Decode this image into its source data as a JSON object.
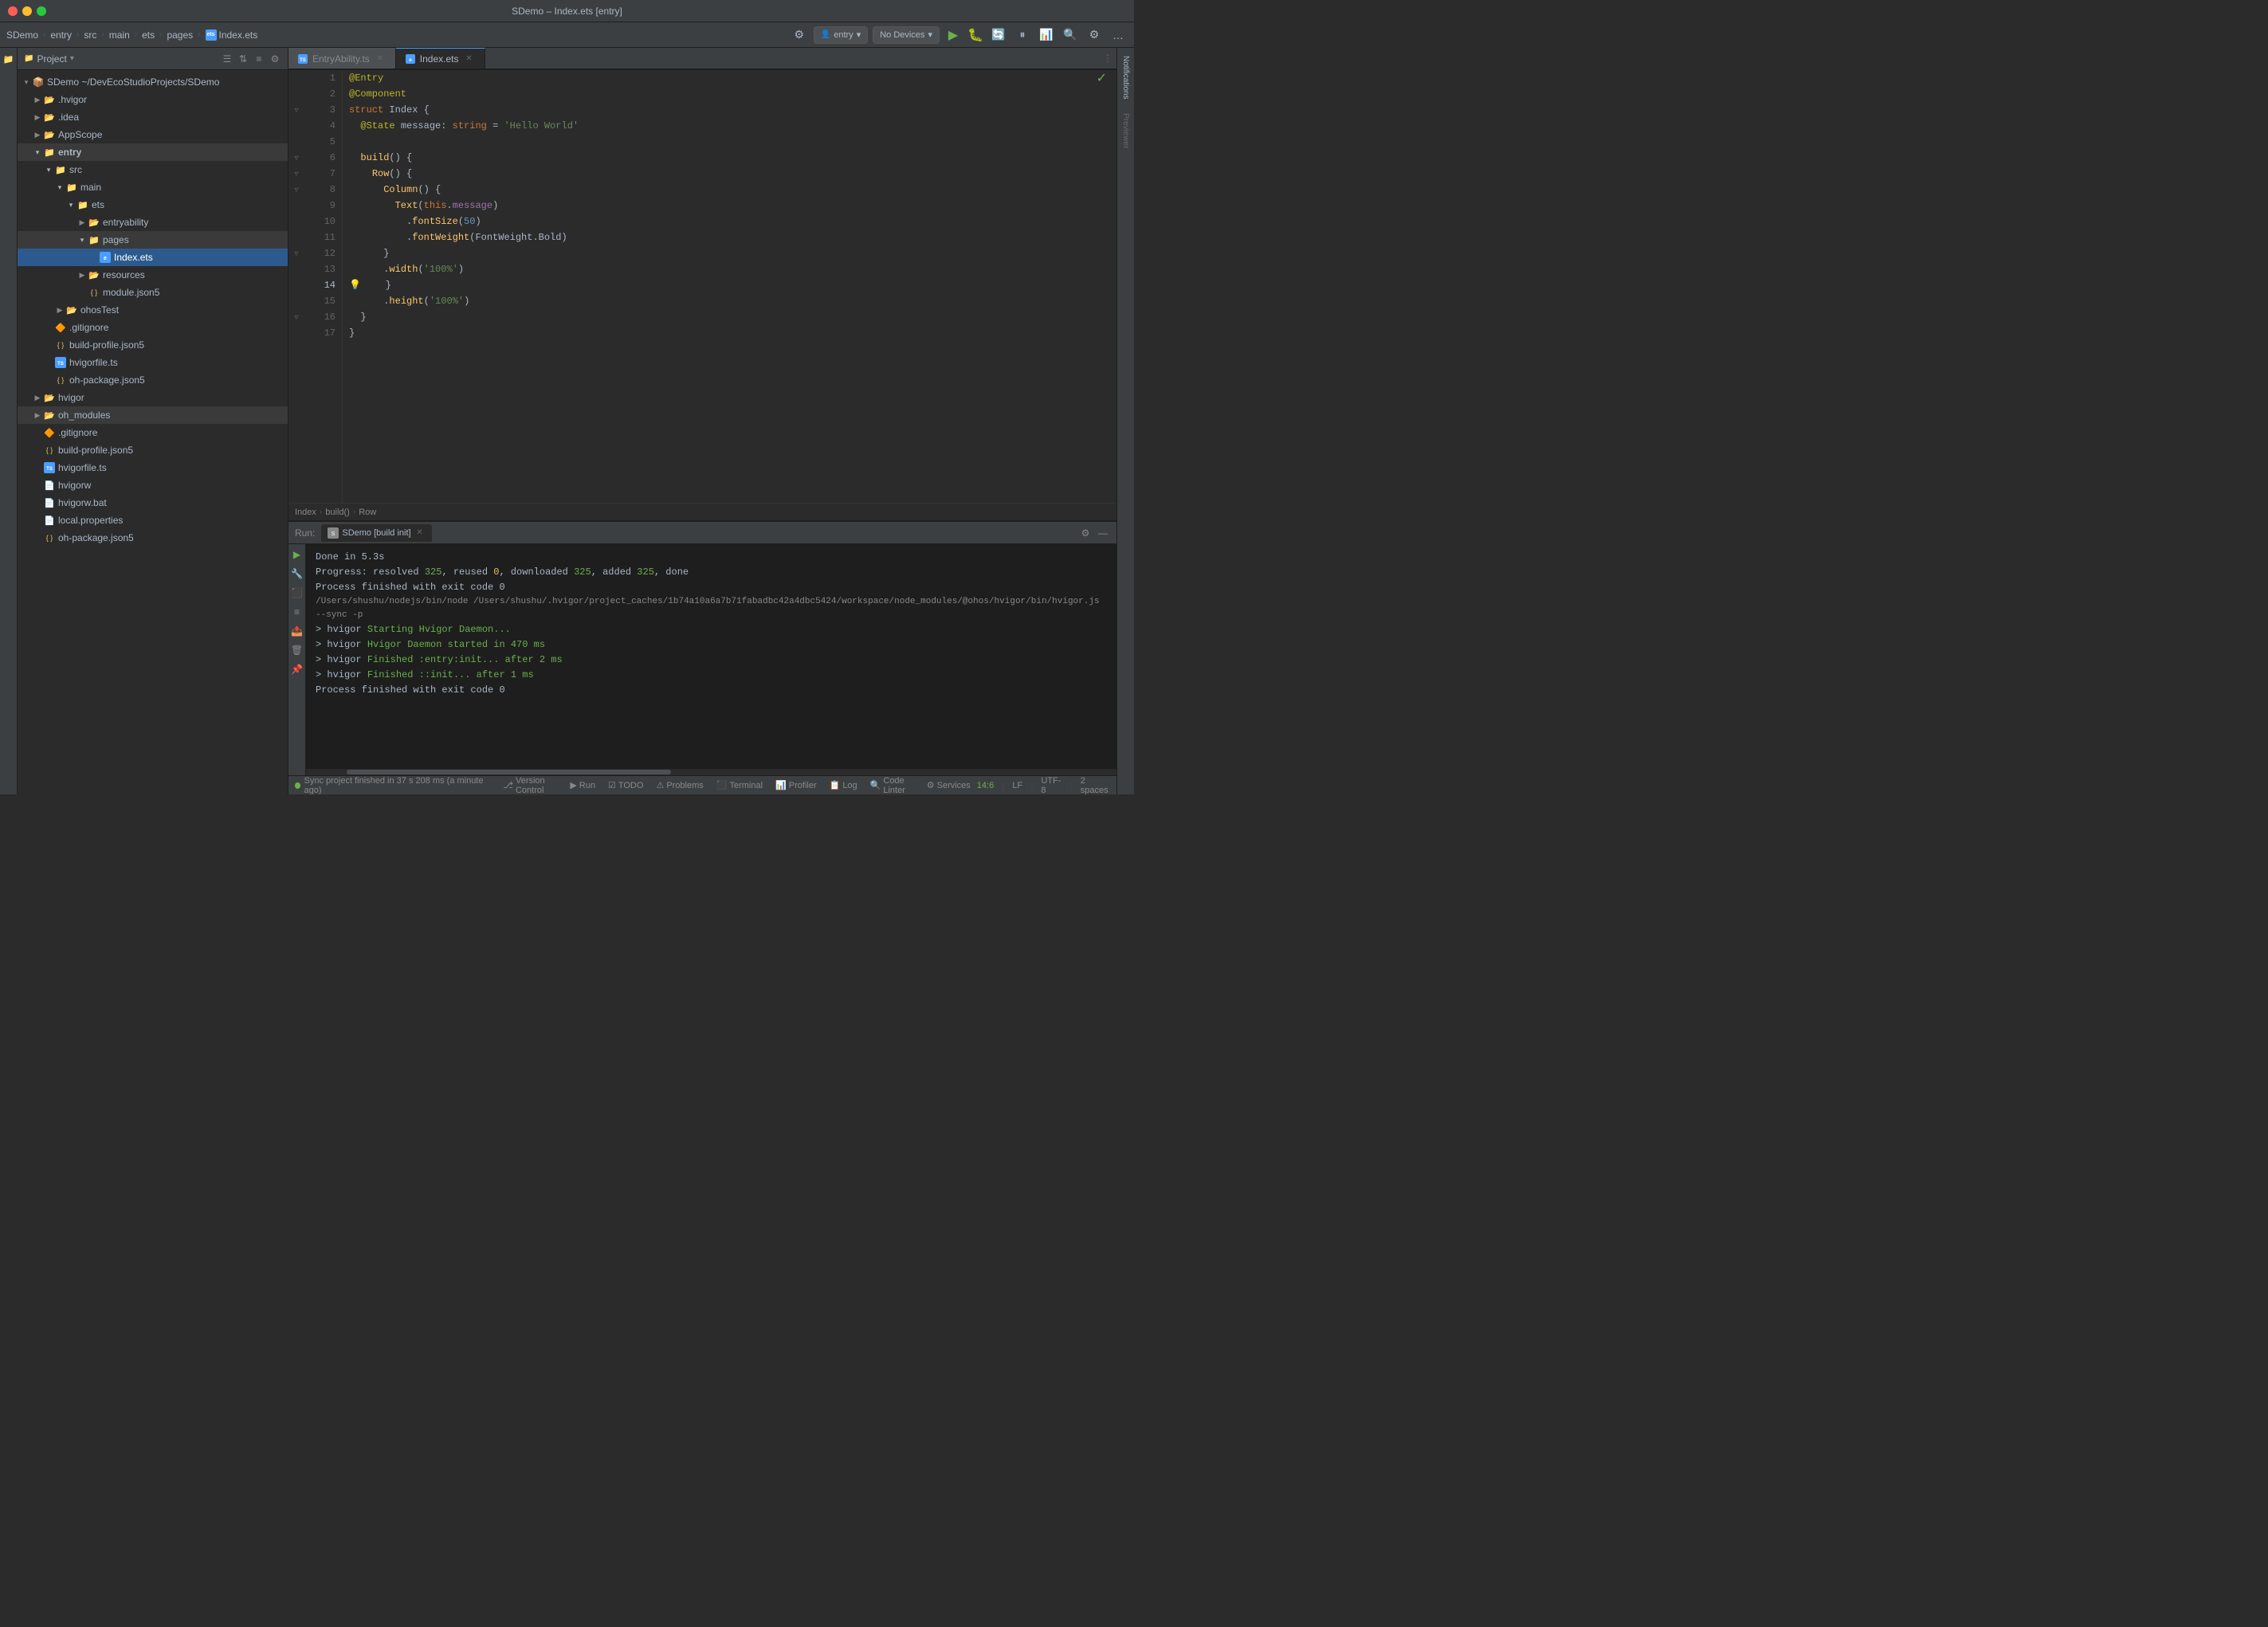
{
  "window": {
    "title": "SDemo – Index.ets [entry]",
    "traffic_lights": {
      "close": "close",
      "minimize": "minimize",
      "maximize": "maximize"
    }
  },
  "breadcrumb": {
    "items": [
      "SDemo",
      "entry",
      "src",
      "main",
      "ets",
      "pages",
      "Index.ets"
    ]
  },
  "toolbar": {
    "entry_label": "entry",
    "entry_chevron": "▾",
    "devices_label": "No Devices",
    "devices_chevron": "▾",
    "run_icon": "▶",
    "icons": [
      "⚙",
      "🔨",
      "🔍",
      "⚙",
      "…"
    ]
  },
  "project_panel": {
    "title": "Project",
    "title_chevron": "▾",
    "tree": [
      {
        "level": 0,
        "label": "SDemo ~/DevEcoStudioProjects/SDemo",
        "type": "root",
        "open": true,
        "arrow": "▾"
      },
      {
        "level": 1,
        "label": ".hvigor",
        "type": "folder",
        "open": false,
        "arrow": "▶"
      },
      {
        "level": 1,
        "label": ".idea",
        "type": "folder",
        "open": false,
        "arrow": "▶"
      },
      {
        "level": 1,
        "label": "AppScope",
        "type": "folder",
        "open": false,
        "arrow": "▶"
      },
      {
        "level": 1,
        "label": "entry",
        "type": "folder",
        "open": true,
        "arrow": "▾"
      },
      {
        "level": 2,
        "label": "src",
        "type": "folder",
        "open": true,
        "arrow": "▾"
      },
      {
        "level": 3,
        "label": "main",
        "type": "folder",
        "open": true,
        "arrow": "▾"
      },
      {
        "level": 4,
        "label": "ets",
        "type": "folder",
        "open": true,
        "arrow": "▾"
      },
      {
        "level": 5,
        "label": "entryability",
        "type": "folder",
        "open": false,
        "arrow": "▶"
      },
      {
        "level": 5,
        "label": "pages",
        "type": "folder",
        "open": true,
        "arrow": "▾"
      },
      {
        "level": 6,
        "label": "Index.ets",
        "type": "file-ts",
        "selected": true
      },
      {
        "level": 4,
        "label": "resources",
        "type": "folder",
        "open": false,
        "arrow": "▶"
      },
      {
        "level": 4,
        "label": "module.json5",
        "type": "file-json"
      },
      {
        "level": 3,
        "label": "ohosTest",
        "type": "folder",
        "open": false,
        "arrow": "▶"
      },
      {
        "level": 2,
        "label": ".gitignore",
        "type": "file-git"
      },
      {
        "level": 2,
        "label": "build-profile.json5",
        "type": "file-json"
      },
      {
        "level": 2,
        "label": "hvigorfile.ts",
        "type": "file-ts"
      },
      {
        "level": 2,
        "label": "oh-package.json5",
        "type": "file-json"
      },
      {
        "level": 1,
        "label": "hvigor",
        "type": "folder",
        "open": false,
        "arrow": "▶"
      },
      {
        "level": 1,
        "label": "oh_modules",
        "type": "folder",
        "open": false,
        "arrow": "▶"
      },
      {
        "level": 1,
        "label": ".gitignore",
        "type": "file-git"
      },
      {
        "level": 1,
        "label": "build-profile.json5",
        "type": "file-json"
      },
      {
        "level": 1,
        "label": "hvigorfile.ts",
        "type": "file-ts"
      },
      {
        "level": 1,
        "label": "hvigorw",
        "type": "file"
      },
      {
        "level": 1,
        "label": "hvigorw.bat",
        "type": "file"
      },
      {
        "level": 1,
        "label": "local.properties",
        "type": "file"
      },
      {
        "level": 1,
        "label": "oh-package.json5",
        "type": "file-json"
      }
    ]
  },
  "tabs": [
    {
      "label": "EntryAbility.ts",
      "active": false,
      "closeable": true
    },
    {
      "label": "Index.ets",
      "active": true,
      "closeable": true
    }
  ],
  "code": {
    "lines": [
      {
        "num": 1,
        "tokens": [
          {
            "t": "@Entry",
            "c": "decorator"
          }
        ],
        "fold": false,
        "hint": false,
        "gutter": ""
      },
      {
        "num": 2,
        "tokens": [
          {
            "t": "@Component",
            "c": "decorator"
          }
        ],
        "fold": false,
        "hint": false,
        "gutter": ""
      },
      {
        "num": 3,
        "tokens": [
          {
            "t": "struct ",
            "c": "kw"
          },
          {
            "t": "Index ",
            "c": "plain"
          },
          {
            "t": "{",
            "c": "plain"
          }
        ],
        "fold": true,
        "hint": false,
        "gutter": ""
      },
      {
        "num": 4,
        "tokens": [
          {
            "t": "  @State ",
            "c": "decorator"
          },
          {
            "t": "message",
            "c": "plain"
          },
          {
            "t": ": ",
            "c": "plain"
          },
          {
            "t": "string",
            "c": "kw"
          },
          {
            "t": " = ",
            "c": "plain"
          },
          {
            "t": "'Hello World'",
            "c": "string"
          }
        ],
        "fold": false,
        "hint": false,
        "gutter": ""
      },
      {
        "num": 5,
        "tokens": [],
        "fold": false,
        "hint": false,
        "gutter": ""
      },
      {
        "num": 6,
        "tokens": [
          {
            "t": "  ",
            "c": "plain"
          },
          {
            "t": "build",
            "c": "method"
          },
          {
            "t": "() {",
            "c": "plain"
          }
        ],
        "fold": true,
        "hint": false,
        "gutter": ""
      },
      {
        "num": 7,
        "tokens": [
          {
            "t": "    ",
            "c": "plain"
          },
          {
            "t": "Row",
            "c": "method"
          },
          {
            "t": "() ",
            "c": "plain"
          },
          {
            "t": "{",
            "c": "plain"
          }
        ],
        "fold": true,
        "hint": false,
        "gutter": ""
      },
      {
        "num": 8,
        "tokens": [
          {
            "t": "      ",
            "c": "plain"
          },
          {
            "t": "Column",
            "c": "method"
          },
          {
            "t": "() {",
            "c": "plain"
          }
        ],
        "fold": true,
        "hint": false,
        "gutter": ""
      },
      {
        "num": 9,
        "tokens": [
          {
            "t": "        ",
            "c": "plain"
          },
          {
            "t": "Text",
            "c": "method"
          },
          {
            "t": "(",
            "c": "plain"
          },
          {
            "t": "this",
            "c": "kw"
          },
          {
            "t": ".",
            "c": "plain"
          },
          {
            "t": "message",
            "c": "property"
          },
          {
            "t": ")",
            "c": "plain"
          }
        ],
        "fold": false,
        "hint": false,
        "gutter": ""
      },
      {
        "num": 10,
        "tokens": [
          {
            "t": "          .",
            "c": "plain"
          },
          {
            "t": "fontSize",
            "c": "method"
          },
          {
            "t": "(",
            "c": "plain"
          },
          {
            "t": "50",
            "c": "number"
          },
          {
            "t": ")",
            "c": "plain"
          }
        ],
        "fold": false,
        "hint": false,
        "gutter": ""
      },
      {
        "num": 11,
        "tokens": [
          {
            "t": "          .",
            "c": "plain"
          },
          {
            "t": "fontWeight",
            "c": "method"
          },
          {
            "t": "(",
            "c": "plain"
          },
          {
            "t": "FontWeight",
            "c": "plain"
          },
          {
            "t": ".Bold",
            "c": "plain"
          },
          {
            "t": ")",
            "c": "plain"
          }
        ],
        "fold": false,
        "hint": false,
        "gutter": ""
      },
      {
        "num": 12,
        "tokens": [
          {
            "t": "      ",
            "c": "plain"
          },
          {
            "t": "}",
            "c": "plain"
          }
        ],
        "fold": true,
        "hint": false,
        "gutter": ""
      },
      {
        "num": 13,
        "tokens": [
          {
            "t": "      .",
            "c": "plain"
          },
          {
            "t": "width",
            "c": "method"
          },
          {
            "t": "(",
            "c": "plain"
          },
          {
            "t": "'100%'",
            "c": "string"
          },
          {
            "t": ")",
            "c": "plain"
          }
        ],
        "fold": false,
        "hint": false,
        "gutter": ""
      },
      {
        "num": 14,
        "tokens": [
          {
            "t": "    ",
            "c": "plain"
          },
          {
            "t": "}",
            "c": "plain"
          }
        ],
        "fold": false,
        "hint": true,
        "gutter": ""
      },
      {
        "num": 15,
        "tokens": [
          {
            "t": "      .",
            "c": "plain"
          },
          {
            "t": "height",
            "c": "method"
          },
          {
            "t": "(",
            "c": "plain"
          },
          {
            "t": "'100%'",
            "c": "string"
          },
          {
            "t": ")",
            "c": "plain"
          }
        ],
        "fold": false,
        "hint": false,
        "gutter": ""
      },
      {
        "num": 16,
        "tokens": [
          {
            "t": "  ",
            "c": "plain"
          },
          {
            "t": "}",
            "c": "plain"
          }
        ],
        "fold": true,
        "hint": false,
        "gutter": ""
      },
      {
        "num": 17,
        "tokens": [
          {
            "t": "}",
            "c": "plain"
          }
        ],
        "fold": false,
        "hint": false,
        "gutter": ""
      }
    ],
    "checkmark_line": 1
  },
  "breadcrumb_bar": {
    "items": [
      "Index",
      "build()",
      "Row"
    ]
  },
  "right_panels": {
    "notifications": "Notifications",
    "previewer": "Previewer"
  },
  "bottom_panel": {
    "run_label": "Run:",
    "tab_label": "SDemo [build init]",
    "output_lines": [
      {
        "text": "",
        "type": "plain"
      },
      {
        "text": "Done in 5.3s",
        "type": "plain"
      },
      {
        "text": "Progress: resolved 325, reused 0, downloaded 325, added 325, done",
        "type": "mixed",
        "parts": [
          {
            "t": "Progress: resolved ",
            "c": "plain"
          },
          {
            "t": "325",
            "c": "highlight"
          },
          {
            "t": ", reused ",
            "c": "plain"
          },
          {
            "t": "0",
            "c": "zero"
          },
          {
            "t": ", downloaded ",
            "c": "plain"
          },
          {
            "t": "325",
            "c": "highlight"
          },
          {
            "t": ", added ",
            "c": "plain"
          },
          {
            "t": "325",
            "c": "highlight"
          },
          {
            "t": ", done",
            "c": "plain"
          }
        ]
      },
      {
        "text": "",
        "type": "plain"
      },
      {
        "text": "Process finished with exit code 0",
        "type": "plain"
      },
      {
        "text": "/Users/shushu/nodejs/bin/node /Users/shushu/.hvigor/project_caches/1b74a10a6a7b71fabadbc42a4dbc5424/workspace/node_modules/@ohos/hvigor/bin/hvigor.js --sync -p",
        "type": "path"
      },
      {
        "text": "> hvigor Starting Hvigor Daemon...",
        "type": "cmd"
      },
      {
        "text": "> hvigor Hvigor Daemon started in 470 ms",
        "type": "cmd"
      },
      {
        "text": "> hvigor Finished :entry:init... after 2 ms",
        "type": "cmd"
      },
      {
        "text": "> hvigor Finished ::init... after 1 ms",
        "type": "cmd"
      },
      {
        "text": "",
        "type": "plain"
      },
      {
        "text": "Process finished with exit code 0",
        "type": "plain"
      }
    ]
  },
  "status_bar": {
    "sync_text": "Sync project finished in 37 s 208 ms (a minute ago)",
    "position": "14:6",
    "line_ending": "LF",
    "encoding": "UTF-8",
    "indent": "2 spaces",
    "tabs": [
      {
        "label": "Version Control",
        "icon": "⎇"
      },
      {
        "label": "Run",
        "icon": "▶"
      },
      {
        "label": "TODO",
        "icon": "☑"
      },
      {
        "label": "Problems",
        "icon": "⚠"
      },
      {
        "label": "Terminal",
        "icon": "⬛"
      },
      {
        "label": "Profiler",
        "icon": "📊"
      },
      {
        "label": "Log",
        "icon": "📋"
      },
      {
        "label": "Code Linter",
        "icon": "🔍"
      },
      {
        "label": "Services",
        "icon": "⚙"
      }
    ]
  }
}
